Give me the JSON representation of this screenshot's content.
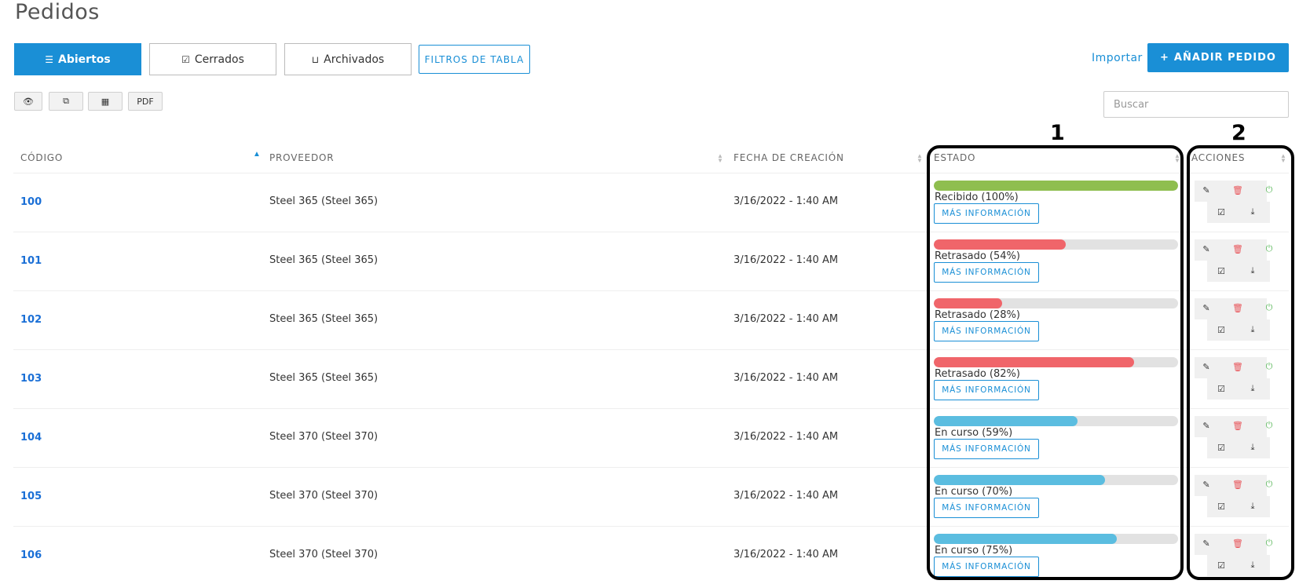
{
  "page": {
    "title": "Pedidos"
  },
  "tabs": [
    {
      "label": "Abiertos",
      "icon": "list-icon",
      "active": true
    },
    {
      "label": "Cerrados",
      "icon": "check-square-icon",
      "active": false
    },
    {
      "label": "Archivados",
      "icon": "inbox-icon",
      "active": false
    }
  ],
  "toolbar": {
    "filters_label": "FILTROS DE TABLA",
    "import_label": "Importar",
    "add_label": "AÑADIR PEDIDO",
    "export_buttons": [
      {
        "icon": "eye-icon"
      },
      {
        "icon": "copy-icon"
      },
      {
        "icon": "table-icon"
      },
      {
        "label": "PDF"
      }
    ]
  },
  "search": {
    "placeholder": "Buscar",
    "value": ""
  },
  "table": {
    "columns": [
      "CÓDIGO",
      "PROVEEDOR",
      "FECHA DE CREACIÓN",
      "ESTADO",
      "ACCIONES"
    ],
    "sorted_column": "CÓDIGO",
    "more_info_label": "MÁS INFORMACIÓN",
    "rows": [
      {
        "code": "100",
        "provider": "Steel 365 (Steel 365)",
        "date": "3/16/2022 - 1:40 AM",
        "status": "Recibido (100%)",
        "progress": 1.0,
        "color": "#8fbe4f"
      },
      {
        "code": "101",
        "provider": "Steel 365 (Steel 365)",
        "date": "3/16/2022 - 1:40 AM",
        "status": "Retrasado (54%)",
        "progress": 0.54,
        "color": "#f0656a"
      },
      {
        "code": "102",
        "provider": "Steel 365 (Steel 365)",
        "date": "3/16/2022 - 1:40 AM",
        "status": "Retrasado (28%)",
        "progress": 0.28,
        "color": "#f0656a"
      },
      {
        "code": "103",
        "provider": "Steel 365 (Steel 365)",
        "date": "3/16/2022 - 1:40 AM",
        "status": "Retrasado (82%)",
        "progress": 0.82,
        "color": "#f0656a"
      },
      {
        "code": "104",
        "provider": "Steel 370 (Steel 370)",
        "date": "3/16/2022 - 1:40 AM",
        "status": "En curso (59%)",
        "progress": 0.59,
        "color": "#5bbde0"
      },
      {
        "code": "105",
        "provider": "Steel 370 (Steel 370)",
        "date": "3/16/2022 - 1:40 AM",
        "status": "En curso (70%)",
        "progress": 0.7,
        "color": "#5bbde0"
      },
      {
        "code": "106",
        "provider": "Steel 370 (Steel 370)",
        "date": "3/16/2022 - 1:40 AM",
        "status": "En curso (75%)",
        "progress": 0.75,
        "color": "#5bbde0"
      }
    ],
    "action_icons": [
      "edit-icon",
      "trash-icon",
      "power-icon",
      "check-square-icon",
      "download-icon"
    ]
  },
  "annotations": [
    "1",
    "2"
  ]
}
